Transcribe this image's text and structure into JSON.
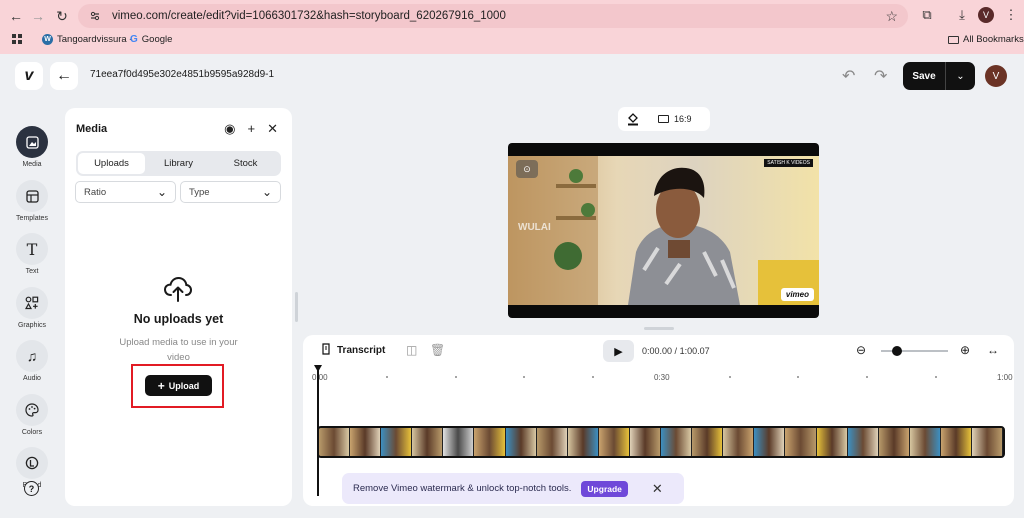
{
  "browser": {
    "url": "vimeo.com/create/edit?vid=1066301732&hash=storyboard_620267916_1000",
    "profile_initial": "V",
    "bookmarks": [
      {
        "label": "Tangoardvissura -"
      },
      {
        "label": "Google"
      }
    ],
    "all_bookmarks_label": "All Bookmarks"
  },
  "header": {
    "project_title": "71eea7f0d495e302e4851b9595a928d9-1",
    "save_label": "Save",
    "user_initial": "V"
  },
  "rail": [
    {
      "label": "Media",
      "icon": "image-icon",
      "active": true
    },
    {
      "label": "Templates",
      "icon": "template-icon"
    },
    {
      "label": "Text",
      "icon": "text-icon"
    },
    {
      "label": "Graphics",
      "icon": "shapes-icon"
    },
    {
      "label": "Audio",
      "icon": "music-icon"
    },
    {
      "label": "Colors",
      "icon": "palette-icon"
    },
    {
      "label": "Brand",
      "icon": "brand-icon"
    }
  ],
  "panel": {
    "title": "Media",
    "tabs": [
      "Uploads",
      "Library",
      "Stock"
    ],
    "active_tab": "Uploads",
    "ratio_label": "Ratio",
    "type_label": "Type",
    "empty_title": "No uploads yet",
    "empty_hint": "Upload media to use in your video",
    "upload_label": "Upload"
  },
  "canvas": {
    "aspect_label": "16:9",
    "watermark_text": "vimeo",
    "overlay_text": "WULAI",
    "channel_badge": "SATISH K VIDEOS"
  },
  "timeline": {
    "transcript_label": "Transcript",
    "current_time": "0:00.00",
    "total_time": "1:00.07",
    "timecode_separator": "/",
    "ruler_labels": [
      "0:00",
      "0:30",
      "1:00"
    ]
  },
  "banner": {
    "text": "Remove Vimeo watermark & unlock top-notch tools.",
    "upgrade_label": "Upgrade"
  },
  "colors": {
    "accent": "#6f49d9",
    "highlight": "#e21b24",
    "chrome": "#f9d4d8"
  }
}
